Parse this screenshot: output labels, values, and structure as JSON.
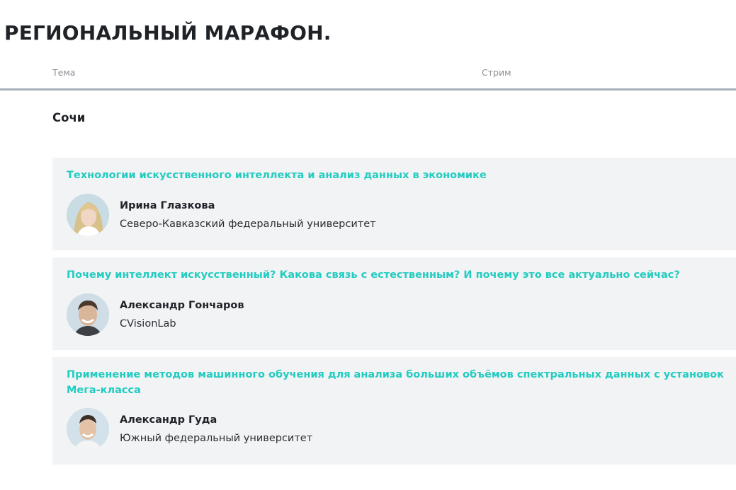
{
  "page": {
    "title": "РЕГИОНАЛЬНЫЙ МАРАФОН."
  },
  "table_header": {
    "topic_label": "Тема",
    "stream_label": "Стрим"
  },
  "section": {
    "city": "Сочи"
  },
  "talks": [
    {
      "title": "Технологии искусственного интеллекта и анализ данных в экономике",
      "speaker_name": "Ирина Глазкова",
      "speaker_org": "Северо-Кавказский федеральный университет"
    },
    {
      "title": "Почему интеллект искусственный? Какова связь с естественным? И почему это все актуально сейчас?",
      "speaker_name": "Александр Гончаров",
      "speaker_org": "CVisionLab"
    },
    {
      "title": "Применение методов машинного обучения для анализа больших объёмов спектральных данных с установок Мега-класса",
      "speaker_name": "Александр Гуда",
      "speaker_org": "Южный федеральный университет"
    }
  ],
  "colors": {
    "accent": "#22ccc0",
    "card_background": "#f2f3f5",
    "rule": "#a7b1b9",
    "text": "#1f2328",
    "muted": "#8a8f94"
  }
}
